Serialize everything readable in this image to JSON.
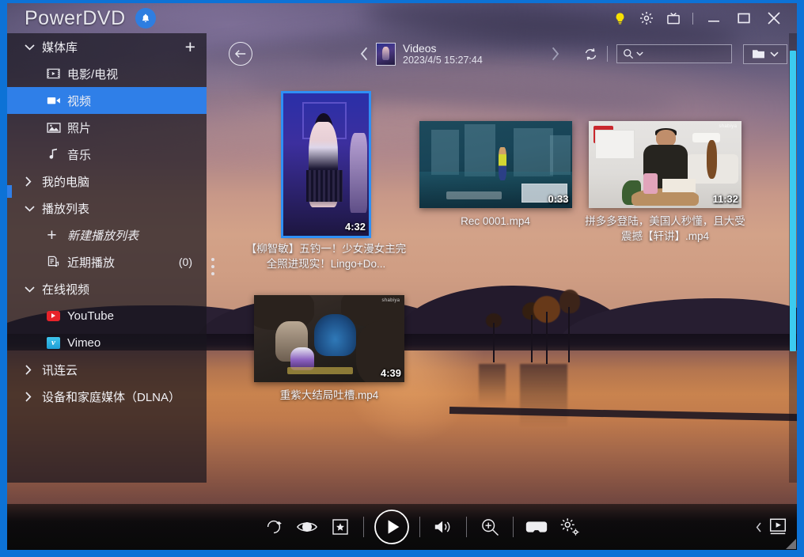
{
  "app": {
    "brand": "PowerDVD",
    "notification_icon": "bell-icon"
  },
  "titlebar": {
    "lightbulb_label": "lightbulb-icon",
    "settings_label": "gear-icon",
    "tv_label": "tv-icon",
    "minimize_label": "minimize-icon",
    "maximize_label": "maximize-icon",
    "close_label": "close-icon",
    "accent": "#2f7fe8",
    "bulb_color": "#f6e000"
  },
  "sidebar": {
    "groups": [
      {
        "label": "媒体库",
        "expanded": true,
        "has_add": true,
        "add_label": "+",
        "items": [
          {
            "label": "电影/电视",
            "icon": "film-icon",
            "selected": false
          },
          {
            "label": "视频",
            "icon": "video-camera-icon",
            "selected": true
          },
          {
            "label": "照片",
            "icon": "photo-icon",
            "selected": false
          },
          {
            "label": "音乐",
            "icon": "music-note-icon",
            "selected": false
          }
        ]
      },
      {
        "label": "我的电脑",
        "expanded": false,
        "items": []
      },
      {
        "label": "播放列表",
        "expanded": true,
        "items": [
          {
            "label": "新建播放列表",
            "icon": "plus-icon",
            "italic": true
          },
          {
            "label": "近期播放",
            "icon": "recent-playlist-icon",
            "count": "(0)"
          }
        ]
      },
      {
        "label": "在线视频",
        "expanded": true,
        "items": [
          {
            "label": "YouTube",
            "icon": "youtube-icon"
          },
          {
            "label": "Vimeo",
            "icon": "vimeo-icon"
          }
        ]
      },
      {
        "label": "讯连云",
        "expanded": false,
        "items": []
      },
      {
        "label": "设备和家庭媒体（DLNA）",
        "expanded": false,
        "items": []
      }
    ],
    "more_options_label": "more-options-icon"
  },
  "topbar": {
    "back_label": "back-arrow-icon",
    "prev_label": "chevron-left-icon",
    "next_label": "chevron-right-icon",
    "breadcrumb": {
      "title": "Videos",
      "subtitle": "2023/4/5 15:27:44"
    },
    "refresh_label": "refresh-icon",
    "search": {
      "value": "",
      "placeholder": "",
      "icon": "search-icon",
      "dropdown_icon": "chevron-down-icon"
    },
    "folder_button": {
      "icon": "folder-icon",
      "dropdown_icon": "chevron-down-icon"
    }
  },
  "grid": {
    "items": [
      {
        "title": "【柳智敏】五钓一！少女漫女主完全照进现实！Lingo+Do...",
        "duration": "4:32",
        "selected": true,
        "orientation": "portrait"
      },
      {
        "title": "Rec 0001.mp4",
        "duration": "0:33",
        "selected": false,
        "orientation": "landscape"
      },
      {
        "title": "拼多多登陆，美国人秒懂，且大受震撼【轩讲】.mp4",
        "duration": "11:32",
        "selected": false,
        "orientation": "landscape"
      },
      {
        "title": "重紫大结局吐槽.mp4",
        "duration": "4:39",
        "selected": false,
        "orientation": "landscape"
      }
    ]
  },
  "controls": {
    "buttons": [
      {
        "name": "rotate-icon",
        "label": "旋转"
      },
      {
        "name": "eye-icon",
        "label": "TrueTheater"
      },
      {
        "name": "star-box-icon",
        "label": "书签"
      },
      {
        "name": "play-icon",
        "label": "播放"
      },
      {
        "name": "volume-icon",
        "label": "音量"
      },
      {
        "name": "zoom-in-icon",
        "label": "缩放"
      },
      {
        "name": "vr-icon",
        "label": "VR"
      },
      {
        "name": "settings-gear-icon",
        "label": "设置"
      }
    ],
    "collapse_label": "chevron-left-icon",
    "player_mode_label": "player-window-icon"
  }
}
